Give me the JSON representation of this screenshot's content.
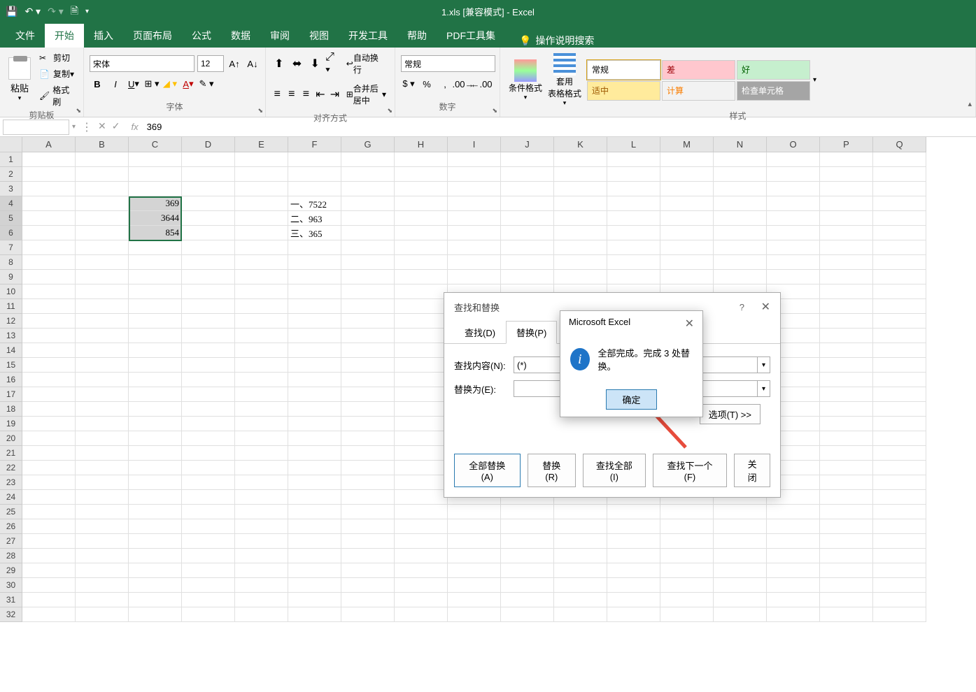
{
  "title": "1.xls  [兼容模式]  -  Excel",
  "qat": {
    "save": "💾",
    "undo": "↶",
    "redo": "↷",
    "preview": "🗎"
  },
  "tabs": [
    "文件",
    "开始",
    "插入",
    "页面布局",
    "公式",
    "数据",
    "审阅",
    "视图",
    "开发工具",
    "帮助",
    "PDF工具集"
  ],
  "tell_me": "操作说明搜索",
  "ribbon": {
    "clipboard": {
      "paste": "粘贴",
      "cut": "剪切",
      "copy": "复制",
      "format_painter": "格式刷",
      "label": "剪贴板"
    },
    "font": {
      "name": "宋体",
      "size": "12",
      "label": "字体"
    },
    "align": {
      "wrap": "自动换行",
      "merge": "合并后居中",
      "label": "对齐方式"
    },
    "number": {
      "format": "常规",
      "label": "数字"
    },
    "styles": {
      "cond": "条件格式",
      "table": "套用\n表格格式",
      "label": "样式",
      "cells": [
        {
          "text": "常规",
          "bg": "#ffffff",
          "fg": "#000"
        },
        {
          "text": "差",
          "bg": "#ffc7ce",
          "fg": "#9c0006"
        },
        {
          "text": "好",
          "bg": "#c6efce",
          "fg": "#006100"
        },
        {
          "text": "适中",
          "bg": "#ffeb9c",
          "fg": "#9c5700"
        },
        {
          "text": "计算",
          "bg": "#f2f2f2",
          "fg": "#fa7d00"
        },
        {
          "text": "检查单元格",
          "bg": "#a5a5a5",
          "fg": "#fff"
        }
      ]
    }
  },
  "formula_bar": {
    "name_box": "",
    "value": "369"
  },
  "columns": [
    "A",
    "B",
    "C",
    "D",
    "E",
    "F",
    "G",
    "H",
    "I",
    "J",
    "K",
    "L",
    "M",
    "N",
    "O",
    "P",
    "Q"
  ],
  "rows": 32,
  "cell_data": {
    "C4": "369",
    "C5": "3644",
    "C6": "854",
    "F4": "一、7522",
    "F5": "二、963",
    "F6": "三、365"
  },
  "selected_range": {
    "startRow": 4,
    "endRow": 6,
    "col": "C"
  },
  "find_replace": {
    "title": "查找和替换",
    "tab_find": "查找(D)",
    "tab_replace": "替换(P)",
    "find_label": "查找内容(N):",
    "find_value": "(*)",
    "replace_label": "替换为(E):",
    "replace_value": "",
    "options": "选项(T) >>",
    "btn_replace_all": "全部替换(A)",
    "btn_replace": "替换(R)",
    "btn_find_all": "查找全部(I)",
    "btn_find_next": "查找下一个(F)",
    "btn_close": "关闭"
  },
  "msgbox": {
    "title": "Microsoft Excel",
    "text": "全部完成。完成 3 处替换。",
    "ok": "确定"
  }
}
